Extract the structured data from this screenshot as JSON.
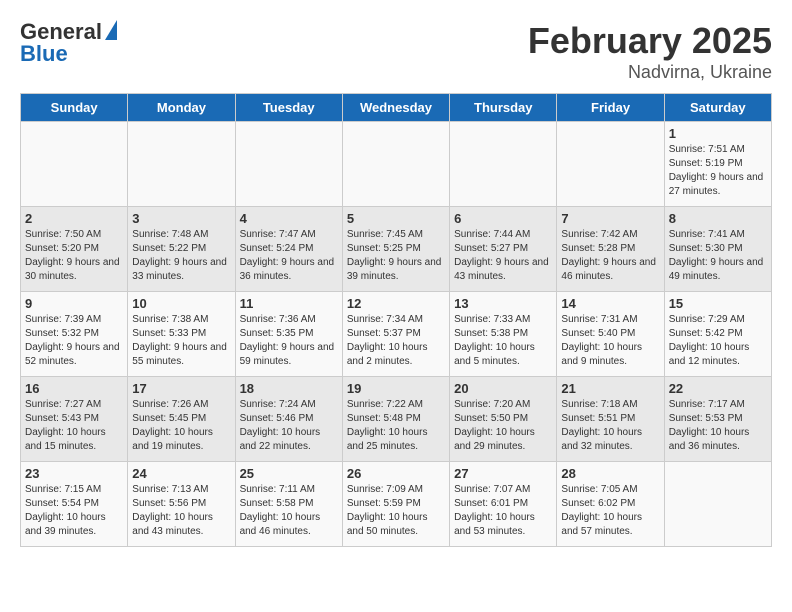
{
  "logo": {
    "line1": "General",
    "line2": "Blue"
  },
  "title": "February 2025",
  "subtitle": "Nadvirna, Ukraine",
  "days_of_week": [
    "Sunday",
    "Monday",
    "Tuesday",
    "Wednesday",
    "Thursday",
    "Friday",
    "Saturday"
  ],
  "weeks": [
    [
      {
        "day": "",
        "info": ""
      },
      {
        "day": "",
        "info": ""
      },
      {
        "day": "",
        "info": ""
      },
      {
        "day": "",
        "info": ""
      },
      {
        "day": "",
        "info": ""
      },
      {
        "day": "",
        "info": ""
      },
      {
        "day": "1",
        "info": "Sunrise: 7:51 AM\nSunset: 5:19 PM\nDaylight: 9 hours and 27 minutes."
      }
    ],
    [
      {
        "day": "2",
        "info": "Sunrise: 7:50 AM\nSunset: 5:20 PM\nDaylight: 9 hours and 30 minutes."
      },
      {
        "day": "3",
        "info": "Sunrise: 7:48 AM\nSunset: 5:22 PM\nDaylight: 9 hours and 33 minutes."
      },
      {
        "day": "4",
        "info": "Sunrise: 7:47 AM\nSunset: 5:24 PM\nDaylight: 9 hours and 36 minutes."
      },
      {
        "day": "5",
        "info": "Sunrise: 7:45 AM\nSunset: 5:25 PM\nDaylight: 9 hours and 39 minutes."
      },
      {
        "day": "6",
        "info": "Sunrise: 7:44 AM\nSunset: 5:27 PM\nDaylight: 9 hours and 43 minutes."
      },
      {
        "day": "7",
        "info": "Sunrise: 7:42 AM\nSunset: 5:28 PM\nDaylight: 9 hours and 46 minutes."
      },
      {
        "day": "8",
        "info": "Sunrise: 7:41 AM\nSunset: 5:30 PM\nDaylight: 9 hours and 49 minutes."
      }
    ],
    [
      {
        "day": "9",
        "info": "Sunrise: 7:39 AM\nSunset: 5:32 PM\nDaylight: 9 hours and 52 minutes."
      },
      {
        "day": "10",
        "info": "Sunrise: 7:38 AM\nSunset: 5:33 PM\nDaylight: 9 hours and 55 minutes."
      },
      {
        "day": "11",
        "info": "Sunrise: 7:36 AM\nSunset: 5:35 PM\nDaylight: 9 hours and 59 minutes."
      },
      {
        "day": "12",
        "info": "Sunrise: 7:34 AM\nSunset: 5:37 PM\nDaylight: 10 hours and 2 minutes."
      },
      {
        "day": "13",
        "info": "Sunrise: 7:33 AM\nSunset: 5:38 PM\nDaylight: 10 hours and 5 minutes."
      },
      {
        "day": "14",
        "info": "Sunrise: 7:31 AM\nSunset: 5:40 PM\nDaylight: 10 hours and 9 minutes."
      },
      {
        "day": "15",
        "info": "Sunrise: 7:29 AM\nSunset: 5:42 PM\nDaylight: 10 hours and 12 minutes."
      }
    ],
    [
      {
        "day": "16",
        "info": "Sunrise: 7:27 AM\nSunset: 5:43 PM\nDaylight: 10 hours and 15 minutes."
      },
      {
        "day": "17",
        "info": "Sunrise: 7:26 AM\nSunset: 5:45 PM\nDaylight: 10 hours and 19 minutes."
      },
      {
        "day": "18",
        "info": "Sunrise: 7:24 AM\nSunset: 5:46 PM\nDaylight: 10 hours and 22 minutes."
      },
      {
        "day": "19",
        "info": "Sunrise: 7:22 AM\nSunset: 5:48 PM\nDaylight: 10 hours and 25 minutes."
      },
      {
        "day": "20",
        "info": "Sunrise: 7:20 AM\nSunset: 5:50 PM\nDaylight: 10 hours and 29 minutes."
      },
      {
        "day": "21",
        "info": "Sunrise: 7:18 AM\nSunset: 5:51 PM\nDaylight: 10 hours and 32 minutes."
      },
      {
        "day": "22",
        "info": "Sunrise: 7:17 AM\nSunset: 5:53 PM\nDaylight: 10 hours and 36 minutes."
      }
    ],
    [
      {
        "day": "23",
        "info": "Sunrise: 7:15 AM\nSunset: 5:54 PM\nDaylight: 10 hours and 39 minutes."
      },
      {
        "day": "24",
        "info": "Sunrise: 7:13 AM\nSunset: 5:56 PM\nDaylight: 10 hours and 43 minutes."
      },
      {
        "day": "25",
        "info": "Sunrise: 7:11 AM\nSunset: 5:58 PM\nDaylight: 10 hours and 46 minutes."
      },
      {
        "day": "26",
        "info": "Sunrise: 7:09 AM\nSunset: 5:59 PM\nDaylight: 10 hours and 50 minutes."
      },
      {
        "day": "27",
        "info": "Sunrise: 7:07 AM\nSunset: 6:01 PM\nDaylight: 10 hours and 53 minutes."
      },
      {
        "day": "28",
        "info": "Sunrise: 7:05 AM\nSunset: 6:02 PM\nDaylight: 10 hours and 57 minutes."
      },
      {
        "day": "",
        "info": ""
      }
    ]
  ]
}
